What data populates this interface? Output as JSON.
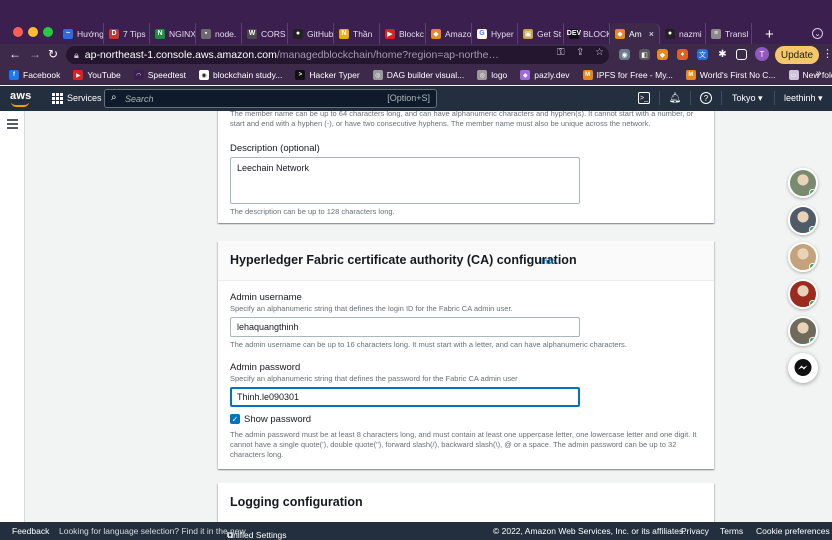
{
  "browser": {
    "tabs": [
      {
        "label": "Hướng",
        "icon": "vietnamese-guide-favicon",
        "color": "#2d6cdf",
        "glyph": "~"
      },
      {
        "label": "7 Tips",
        "icon": "dev-d-favicon",
        "color": "#c0392b",
        "glyph": "D"
      },
      {
        "label": "NGINX",
        "icon": "nginx-favicon",
        "color": "#1a8f3d",
        "glyph": "N"
      },
      {
        "label": "node.",
        "icon": "page-favicon",
        "color": "#6b6b6b",
        "glyph": "▪"
      },
      {
        "label": "CORS",
        "icon": "w3-favicon",
        "color": "#4a4a4a",
        "glyph": "W"
      },
      {
        "label": "GitHub",
        "icon": "github-favicon",
        "color": "#222222",
        "glyph": "●"
      },
      {
        "label": "Thần",
        "icon": "n-favicon",
        "color": "#e7b10a",
        "glyph": "N"
      },
      {
        "label": "Blockc",
        "icon": "youtube-favicon",
        "color": "#e02020",
        "glyph": "▶"
      },
      {
        "label": "Amazo",
        "icon": "aws-favicon",
        "color": "#e8891b",
        "glyph": "◆"
      },
      {
        "label": "Hyper",
        "icon": "google-favicon",
        "color": "#ffffff",
        "glyph": "G"
      },
      {
        "label": "Get St",
        "icon": "package-favicon",
        "color": "#c7a44a",
        "glyph": "▣"
      },
      {
        "label": "BLOCK",
        "icon": "dev-favicon",
        "color": "#111111",
        "glyph": "DEV"
      },
      {
        "label": "Am",
        "icon": "aws-favicon",
        "color": "#e8891b",
        "glyph": "◆",
        "active": true
      },
      {
        "label": "nazmi",
        "icon": "github-favicon",
        "color": "#222222",
        "glyph": "●"
      },
      {
        "label": "Transl",
        "icon": "doc-favicon",
        "color": "#8a8a8a",
        "glyph": "≡"
      }
    ],
    "active_tab_close": "×",
    "new_tab": "+",
    "url_host": "ap-northeast-1.console.aws.amazon.com",
    "url_path": "/managedblockchain/home?region=ap-northe…",
    "update_label": "Update",
    "profile_initial": "T",
    "bookmarks": [
      {
        "label": "Facebook",
        "icon": "facebook-favicon",
        "color": "#1877f2",
        "glyph": "f"
      },
      {
        "label": "YouTube",
        "icon": "youtube-favicon",
        "color": "#e02020",
        "glyph": "▶"
      },
      {
        "label": "Speedtest",
        "icon": "speedtest-favicon",
        "color": "#3a1f4f",
        "glyph": "◠"
      },
      {
        "label": "blockchain study...",
        "icon": "blockchain-favicon",
        "color": "#ffffff",
        "glyph": "◉"
      },
      {
        "label": "Hacker Typer",
        "icon": "hacker-typer-favicon",
        "color": "#111111",
        "glyph": ">"
      },
      {
        "label": "DAG builder visual...",
        "icon": "dag-favicon",
        "color": "#9a9a9a",
        "glyph": "◎"
      },
      {
        "label": "logo",
        "icon": "logo-favicon",
        "color": "#9a9a9a",
        "glyph": "◎"
      },
      {
        "label": "pazly.dev",
        "icon": "pazly-favicon",
        "color": "#a06be0",
        "glyph": "◆"
      },
      {
        "label": "IPFS for Free - My...",
        "icon": "m-favicon",
        "color": "#e8891b",
        "glyph": "M"
      },
      {
        "label": "World's First No C...",
        "icon": "m-favicon",
        "color": "#e8891b",
        "glyph": "M"
      },
      {
        "label": "New folder",
        "icon": "folder-icon",
        "color": "#cfc3da",
        "glyph": "▭"
      }
    ],
    "bookmarks_more": "»"
  },
  "aws_nav": {
    "logo": "aws",
    "services_label": "Services",
    "search_placeholder": "Search",
    "search_shortcut": "[Option+S]",
    "region_label": "Tokyo",
    "user_label": "leethinh"
  },
  "form": {
    "member_name_hint": "The member name can be up to 64 characters long, and can have alphanumeric characters and hyphen(s). It cannot start with a number, or start and end with a hyphen (-), or have two consecutive hyphens. The member name must also be unique across the network.",
    "description_label": "Description (optional)",
    "description_value": "Leechain Network",
    "description_hint": "The description can be up to 128 characters long.",
    "ca_section_title": "Hyperledger Fabric certificate authority (CA) configuration",
    "info_label": "Info",
    "admin_username_label": "Admin username",
    "admin_username_desc": "Specify an alphanumeric string that defines the login ID for the Fabric CA admin user.",
    "admin_username_value": "lehaquangthinh",
    "admin_username_hint": "The admin username can be up to 16 characters long. It must start with a letter, and can have alphanumeric characters.",
    "admin_password_label": "Admin password",
    "admin_password_desc": "Specify an alphanumeric string that defines the password for the Fabric CA admin user",
    "admin_password_value": "Thinh.le090301",
    "show_password_label": "Show password",
    "show_password_checked": true,
    "admin_password_hint": "The admin password must be at least 8 characters long, and must contain at least one uppercase letter, one lowercase letter and one digit. It cannot have a single quote('), double quote(\"), forward slash(/), backward slash(\\), @ or a space. The admin password can be up to 32 characters long.",
    "logging_section_title": "Logging configuration"
  },
  "footer": {
    "feedback": "Feedback",
    "language_prompt": "Looking for language selection? Find it in the new",
    "unified_settings": "Unified Settings",
    "copyright": "© 2022, Amazon Web Services, Inc. or its affiliates.",
    "privacy": "Privacy",
    "terms": "Terms",
    "cookies": "Cookie preferences"
  },
  "chat_heads": [
    {
      "name": "chat-avatar-1",
      "color": "#7a8a6e",
      "online": true
    },
    {
      "name": "chat-avatar-2",
      "color": "#4f5b66",
      "online": true
    },
    {
      "name": "chat-avatar-3",
      "color": "#c4a27c",
      "online": true
    },
    {
      "name": "chat-avatar-4",
      "color": "#9b2a1f",
      "online": true
    },
    {
      "name": "chat-avatar-5",
      "color": "#6e6a5c",
      "online": true
    }
  ],
  "colors": {
    "aws_dark": "#232f3e",
    "aws_orange": "#ff9900",
    "link_blue": "#0073bb",
    "chrome_purple": "#3d2a4b"
  }
}
